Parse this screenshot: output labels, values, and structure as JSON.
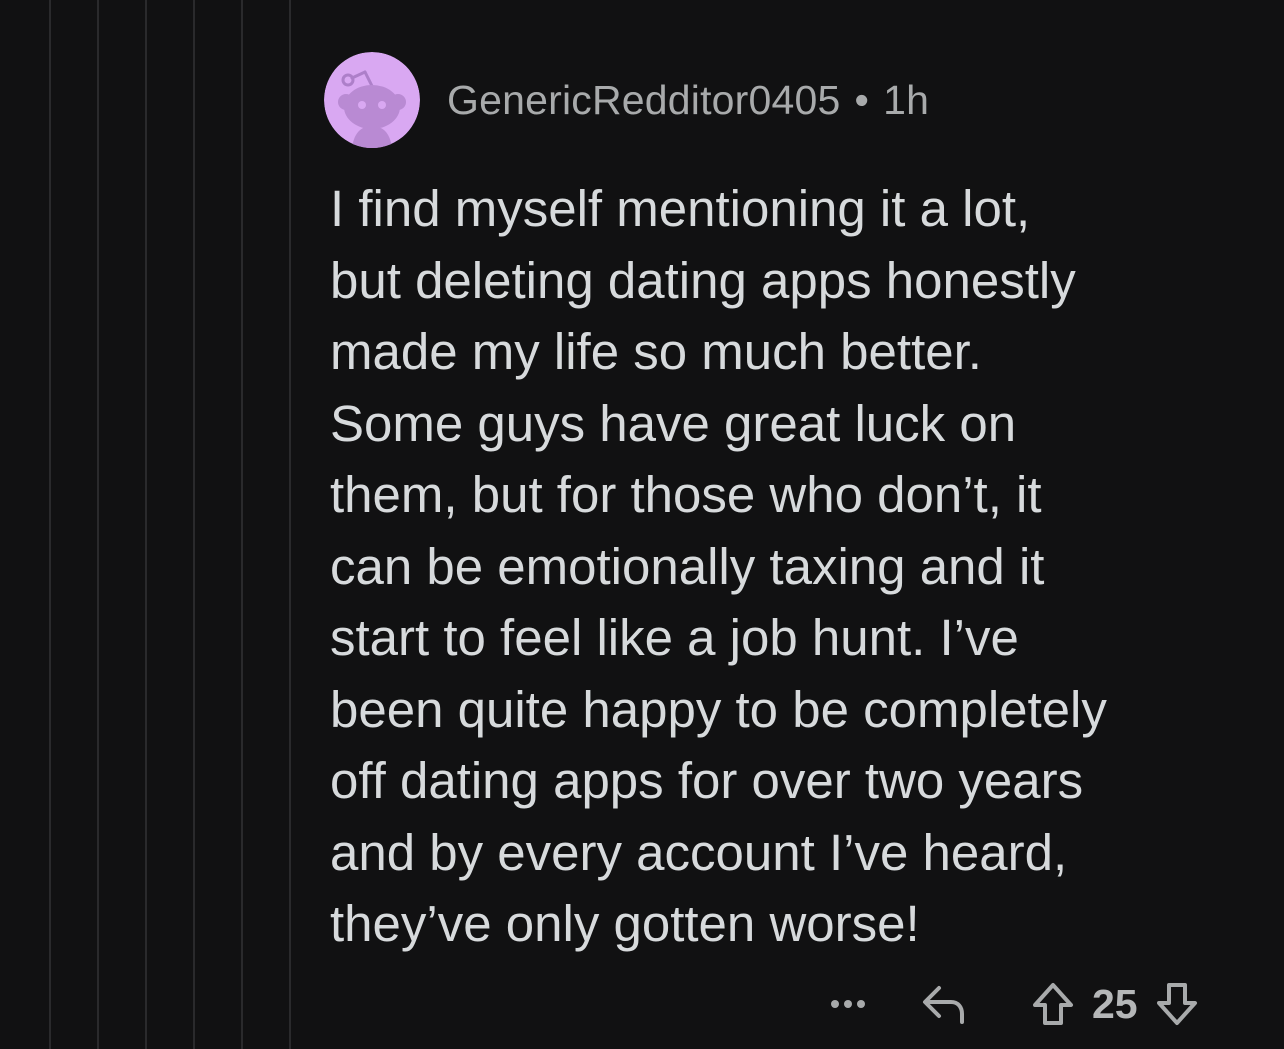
{
  "comment": {
    "author": "GenericRedditor0405",
    "separator": "•",
    "age": "1h",
    "body": "I find myself mentioning it a lot,\nbut deleting dating apps honestly\nmade my life so much better.\nSome guys have great luck on\nthem, but for those who don’t, it\ncan be emotionally taxing and it\nstart to feel like a job hunt. I’ve\nbeen quite happy to be completely\noff dating apps for over two years\nand by every account I’ve heard,\nthey’ve only gotten worse!",
    "vote_count": "25"
  },
  "icons": {
    "avatar": "snoo-avatar",
    "more": "more-options-icon",
    "reply": "reply-arrow-icon",
    "upvote": "upvote-arrow-icon",
    "downvote": "downvote-arrow-icon"
  },
  "colors": {
    "background": "#111112",
    "text": "#d7dadc",
    "meta_text": "#a8aaab",
    "avatar_bg": "#d9a8f2",
    "thread_line": "#2a2a2c"
  }
}
